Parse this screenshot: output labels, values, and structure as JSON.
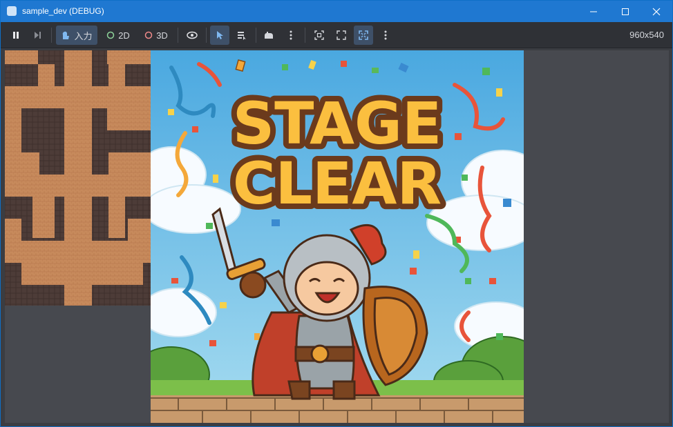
{
  "window": {
    "title": "sample_dev (DEBUG)",
    "accent": "#1f78d1"
  },
  "toolbar": {
    "input_label": "入力",
    "mode_2d": "2D",
    "mode_3d": "3D",
    "resolution": "960x540"
  },
  "scene": {
    "title_line1": "STAGE",
    "title_line2": "CLEAR"
  },
  "icons": [
    "app-icon",
    "minimize-icon",
    "maximize-icon",
    "close-icon",
    "pause-icon",
    "step-frame-icon",
    "input-icon",
    "2d-mode-icon",
    "3d-mode-icon",
    "visibility-icon",
    "select-pointer-icon",
    "list-select-icon",
    "camera-override-icon",
    "more-options-icon",
    "fit-to-view-icon",
    "expand-icon",
    "fullscreen-icon"
  ]
}
